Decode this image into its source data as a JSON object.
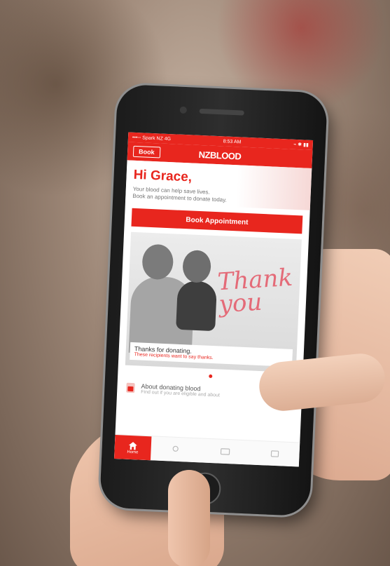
{
  "status_bar": {
    "carrier": "•••◦◦ Spark NZ  4G",
    "time": "8:53 AM",
    "indicators": "⌁ ✱ ▮▮"
  },
  "nav": {
    "book_label": "Book",
    "logo_text": "NZBLOOD"
  },
  "hero": {
    "greeting": "Hi Grace,",
    "subtitle_line1": "Your blood can help save lives.",
    "subtitle_line2": "Book an appointment to donate today."
  },
  "cta": {
    "label": "Book Appointment"
  },
  "card": {
    "thank_text": "Thank you",
    "caption_title": "Thanks for donating.",
    "caption_sub": "These recipients want to say thanks."
  },
  "info": {
    "title": "About donating blood",
    "subtitle": "Find out if you are eligible and about"
  },
  "tabs": [
    {
      "label": "Home",
      "icon": "home-icon",
      "active": true
    },
    {
      "label": "",
      "icon": "location-icon",
      "active": false
    },
    {
      "label": "",
      "icon": "card-icon",
      "active": false
    },
    {
      "label": "",
      "icon": "menu-icon",
      "active": false
    }
  ],
  "colors": {
    "brand_red": "#e8261e",
    "thank_pink": "#e46b78"
  }
}
